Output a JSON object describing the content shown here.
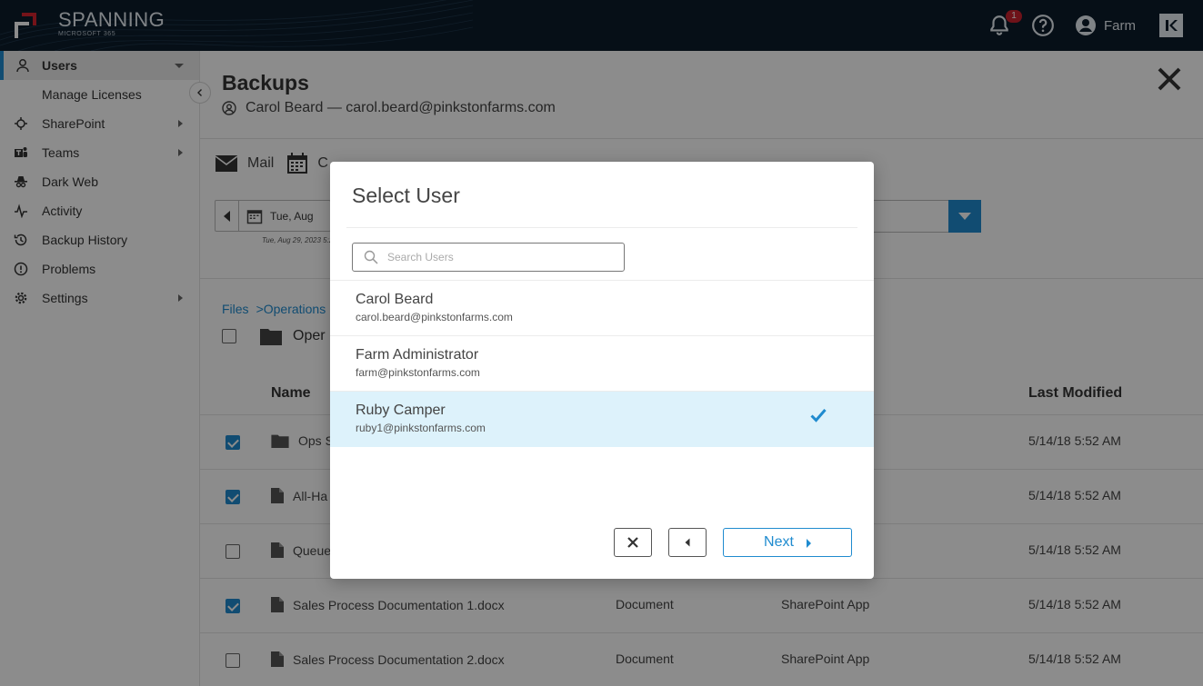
{
  "app": {
    "brand": "SPANNING",
    "product": "MICROSOFT 365",
    "notification_count": "1",
    "user_name": "Farm",
    "colors": {
      "topbar": "#0c1c2b",
      "accent": "#1f8bcf",
      "badge": "#c8212f",
      "selected_row": "#ddf2fb"
    }
  },
  "sidebar": {
    "items": [
      {
        "label": "Users",
        "icon": "user-icon",
        "active": true,
        "has_arrow": true
      },
      {
        "label": "Manage Licenses",
        "sub": true
      },
      {
        "label": "SharePoint",
        "icon": "sharepoint-icon",
        "has_arrow": true
      },
      {
        "label": "Teams",
        "icon": "teams-icon",
        "has_arrow": true
      },
      {
        "label": "Dark Web",
        "icon": "dark-web-icon"
      },
      {
        "label": "Activity",
        "icon": "activity-icon"
      },
      {
        "label": "Backup History",
        "icon": "history-icon"
      },
      {
        "label": "Problems",
        "icon": "alert-icon"
      },
      {
        "label": "Settings",
        "icon": "gear-icon",
        "has_arrow": true
      }
    ]
  },
  "main": {
    "title": "Backups",
    "user_line": "Carol Beard — carol.beard@pinkstonfarms.com",
    "tabs": {
      "mail": "Mail",
      "calendar_partial": "C"
    },
    "date_text": "Tue, Aug",
    "date_sub": "Tue, Aug 29, 2023 5:2",
    "breadcrumb": {
      "root": "Files",
      "current": ">Operations"
    },
    "folder_partial": "Oper",
    "columns": {
      "name": "Name",
      "last_modified": "Last Modified"
    },
    "rows": [
      {
        "name": "Ops S",
        "type": "",
        "source": "",
        "modified": "5/14/18 5:52 AM",
        "checked": true,
        "icon": "folder-icon"
      },
      {
        "name": "All-Ha",
        "type": "",
        "source": "",
        "modified": "5/14/18 5:52 AM",
        "checked": true,
        "icon": "file-icon"
      },
      {
        "name": "Queue",
        "type": "",
        "source": "",
        "modified": "5/14/18 5:52 AM",
        "checked": false,
        "icon": "file-icon"
      },
      {
        "name": "Sales Process Documentation 1.docx",
        "type": "Document",
        "source": "SharePoint App",
        "modified": "5/14/18 5:52 AM",
        "checked": true,
        "icon": "file-icon"
      },
      {
        "name": "Sales Process Documentation 2.docx",
        "type": "Document",
        "source": "SharePoint App",
        "modified": "5/14/18 5:52 AM",
        "checked": false,
        "icon": "file-icon"
      }
    ]
  },
  "modal": {
    "title": "Select User",
    "search_placeholder": "Search Users",
    "users": [
      {
        "name": "Carol Beard",
        "email": "carol.beard@pinkstonfarms.com",
        "selected": false
      },
      {
        "name": "Farm Administrator",
        "email": "farm@pinkstonfarms.com",
        "selected": false
      },
      {
        "name": "Ruby Camper",
        "email": "ruby1@pinkstonfarms.com",
        "selected": true
      }
    ],
    "next_label": "Next"
  }
}
